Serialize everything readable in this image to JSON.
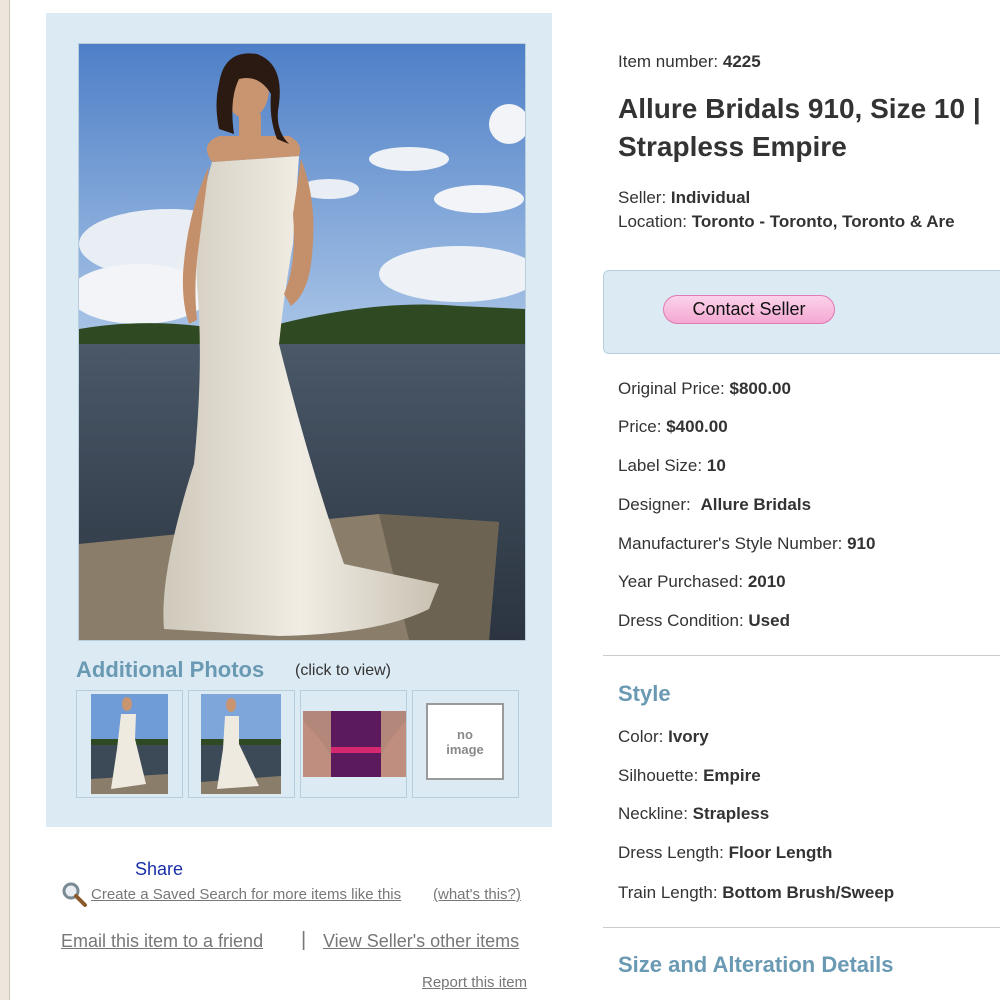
{
  "photos": {
    "title": "Additional Photos",
    "hint": "(click to view)",
    "no_image_line1": "no",
    "no_image_line2": "image"
  },
  "links": {
    "share": "Share",
    "saved_search": "Create a Saved Search for more items like this",
    "whats_this": "(what's this?)",
    "email_friend": "Email this item to a friend",
    "divider": "|",
    "seller_items": "View Seller's other items",
    "report": "Report this item"
  },
  "item": {
    "number_label": "Item number:",
    "number": "4225",
    "title_line1": "Allure Bridals 910, Size 10 |",
    "title_line2": "Strapless Empire",
    "seller_label": "Seller:",
    "seller": "Individual",
    "location_label": "Location:",
    "location": "Toronto - Toronto, Toronto & Are"
  },
  "contact": {
    "button": "Contact Seller"
  },
  "details": [
    {
      "label": "Original Price:",
      "value": "$800.00"
    },
    {
      "label": "Price:",
      "value": "$400.00"
    },
    {
      "label": "Label Size:",
      "value": "10"
    },
    {
      "label": "Designer:",
      "value": "Allure Bridals"
    },
    {
      "label": "Manufacturer's Style Number:",
      "value": "910"
    },
    {
      "label": "Year Purchased:",
      "value": "2010"
    },
    {
      "label": "Dress Condition:",
      "value": "Used"
    }
  ],
  "style": {
    "title": "Style",
    "rows": [
      {
        "label": "Color:",
        "value": "Ivory"
      },
      {
        "label": "Silhouette:",
        "value": "Empire"
      },
      {
        "label": "Neckline:",
        "value": "Strapless"
      },
      {
        "label": "Dress Length:",
        "value": "Floor Length"
      },
      {
        "label": "Train Length:",
        "value": "Bottom Brush/Sweep"
      }
    ]
  },
  "size_section": {
    "title": "Size and Alteration Details"
  },
  "colors": {
    "panel": "#dceaf3",
    "section_title": "#6a9ab3",
    "contact_button": "#f4a8d2",
    "share_link": "#1a2fa8",
    "link_gray": "#777777"
  }
}
